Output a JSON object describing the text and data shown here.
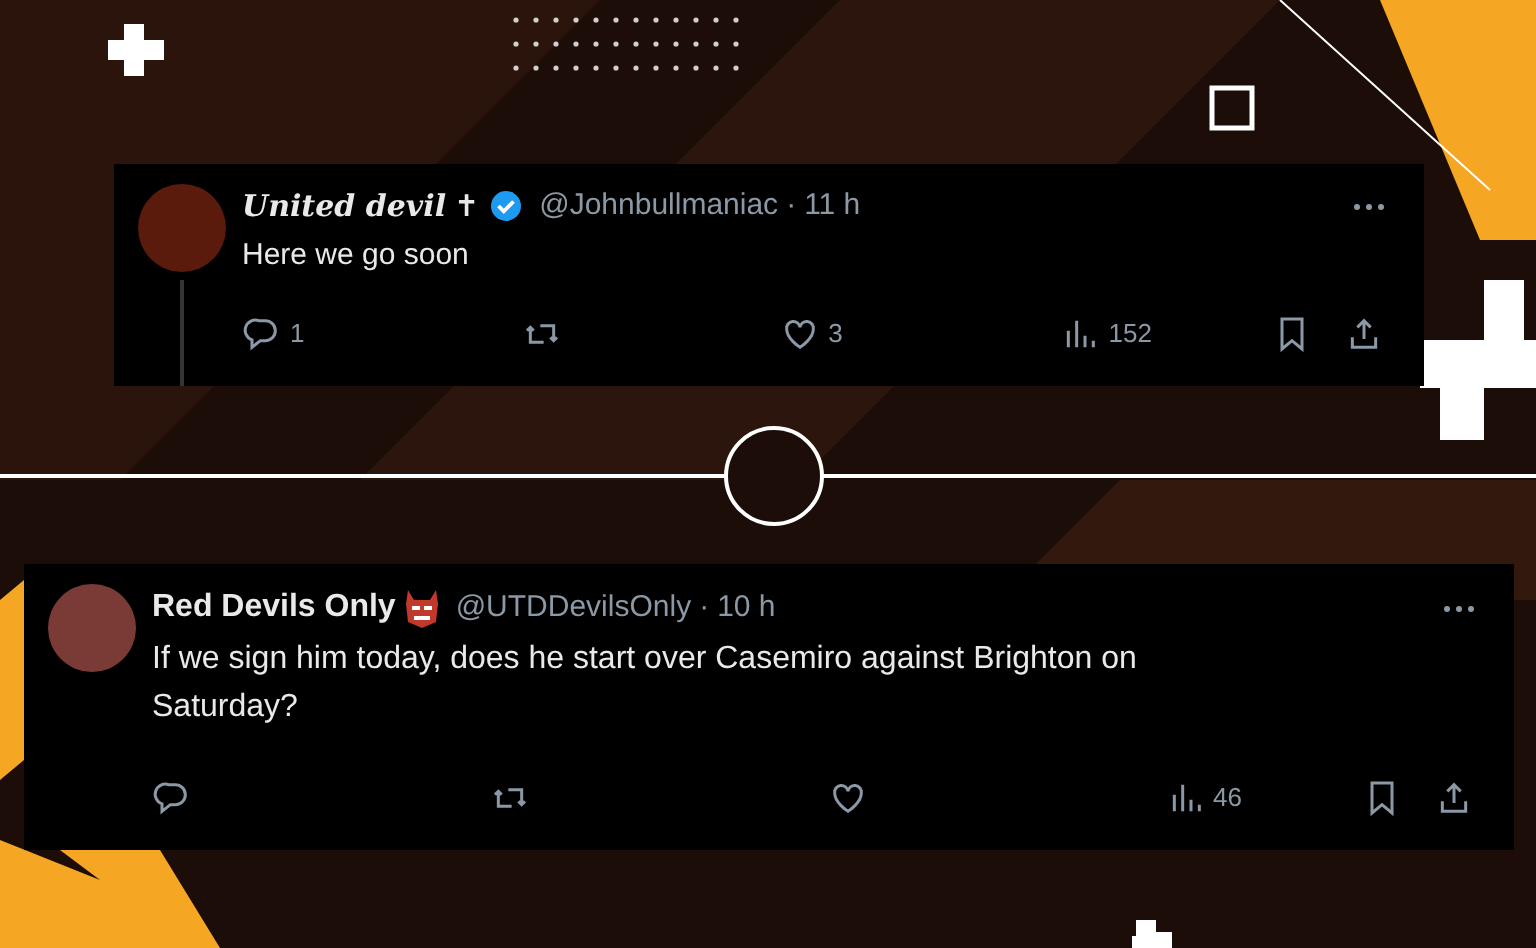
{
  "tweets": [
    {
      "display_name": "United devil",
      "name_suffix": "✝",
      "verified": true,
      "name_emoji": false,
      "handle": "@Johnbullmaniac",
      "separator": "·",
      "time": "11 h",
      "text": "Here we go soon",
      "thread_line": true,
      "replies": "1",
      "likes": "3",
      "views": "152"
    },
    {
      "display_name": "Red Devils Only",
      "verified": false,
      "name_emoji": true,
      "handle": "@UTDDevilsOnly",
      "separator": "·",
      "time": "10 h",
      "text": "If we sign him today, does he start over Casemiro against Brighton on Saturday?",
      "thread_line": false,
      "views": "46"
    }
  ]
}
